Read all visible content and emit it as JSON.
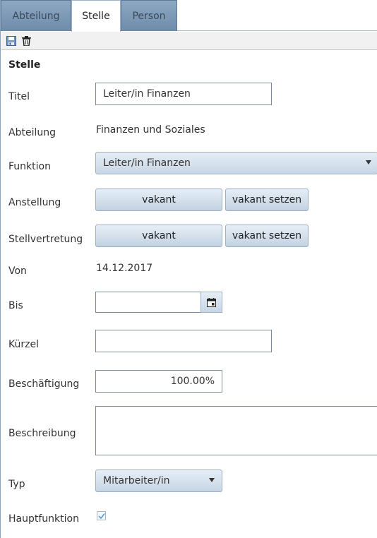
{
  "tabs": [
    {
      "label": "Abteilung",
      "active": false
    },
    {
      "label": "Stelle",
      "active": true
    },
    {
      "label": "Person",
      "active": false
    }
  ],
  "toolbar": {
    "save_icon": "save-icon",
    "delete_icon": "trash-icon"
  },
  "form": {
    "section_title": "Stelle",
    "titel": {
      "label": "Titel",
      "value": "Leiter/in Finanzen"
    },
    "abteilung": {
      "label": "Abteilung",
      "value": "Finanzen und Soziales"
    },
    "funktion": {
      "label": "Funktion",
      "value": "Leiter/in Finanzen"
    },
    "anstellung": {
      "label": "Anstellung",
      "value": "vakant",
      "action": "vakant setzen"
    },
    "stellvertretung": {
      "label": "Stellvertretung",
      "value": "vakant",
      "action": "vakant setzen"
    },
    "von": {
      "label": "Von",
      "value": "14.12.2017"
    },
    "bis": {
      "label": "Bis",
      "value": ""
    },
    "kuerzel": {
      "label": "Kürzel",
      "value": ""
    },
    "beschaeftigung": {
      "label": "Beschäftigung",
      "value": "100.00%"
    },
    "beschreibung": {
      "label": "Beschreibung",
      "value": ""
    },
    "typ": {
      "label": "Typ",
      "value": "Mitarbeiter/in"
    },
    "hauptfunktion": {
      "label": "Hauptfunktion",
      "checked": true
    }
  },
  "colors": {
    "tab_inactive": "#7b97b4",
    "accent_border": "#9bb0c5"
  }
}
